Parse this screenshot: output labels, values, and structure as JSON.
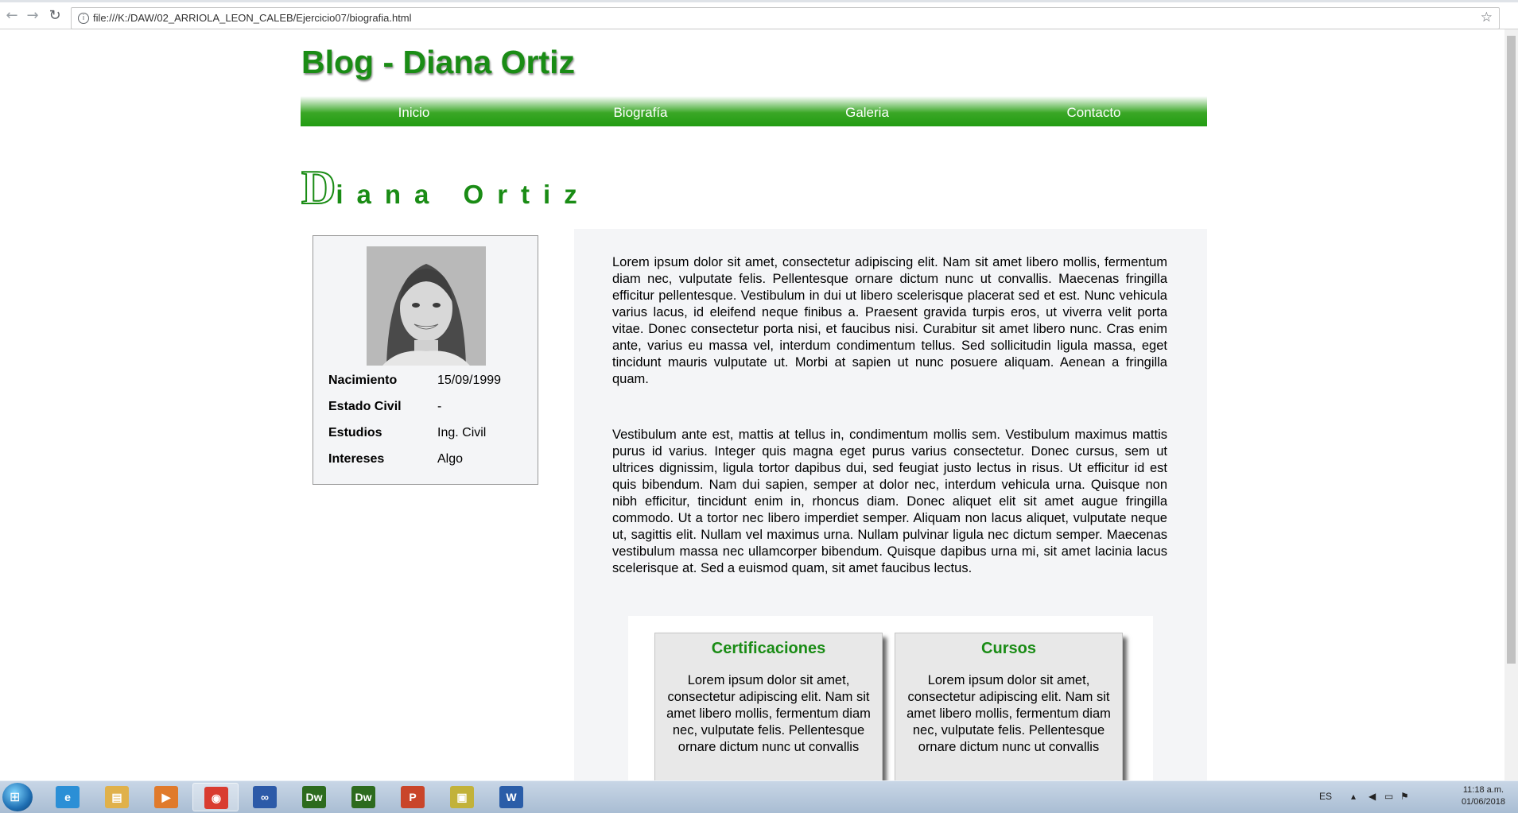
{
  "browser": {
    "url": "file:///K:/DAW/02_ARRIOLA_LEON_CALEB/Ejercicio07/biografia.html",
    "nav_back": "←",
    "nav_forward": "→",
    "reload": "↻",
    "info": "i",
    "bookmark": "☆"
  },
  "site": {
    "title": "Blog - Diana Ortiz",
    "menu": [
      "Inicio",
      "Biografía",
      "Galeria",
      "Contacto"
    ]
  },
  "bio": {
    "heading_first": "D",
    "heading_rest": "iana Ortiz",
    "profile": [
      {
        "label": "Nacimiento",
        "value": "15/09/1999"
      },
      {
        "label": "Estado Civil",
        "value": "-"
      },
      {
        "label": "Estudios",
        "value": "Ing. Civil"
      },
      {
        "label": "Intereses",
        "value": "Algo"
      }
    ],
    "paragraphs": [
      "Lorem ipsum dolor sit amet, consectetur adipiscing elit. Nam sit amet libero mollis, fermentum diam nec, vulputate felis. Pellentesque ornare dictum nunc ut convallis. Maecenas fringilla efficitur pellentesque. Vestibulum in dui ut libero scelerisque placerat sed et est. Nunc vehicula varius lacus, id eleifend neque finibus a. Praesent gravida turpis eros, ut viverra velit porta vitae. Donec consectetur porta nisi, et faucibus nisi. Curabitur sit amet libero nunc. Cras enim ante, varius eu massa vel, interdum condimentum tellus. Sed sollicitudin ligula massa, eget tincidunt mauris vulputate ut. Morbi at sapien ut nunc posuere aliquam. Aenean a fringilla quam.",
      "Vestibulum ante est, mattis at tellus in, condimentum mollis sem. Vestibulum maximus mattis purus id varius. Integer quis magna eget purus varius consectetur. Donec cursus, sem ut ultrices dignissim, ligula tortor dapibus dui, sed feugiat justo lectus in risus. Ut efficitur id est quis bibendum. Nam dui sapien, semper at dolor nec, interdum vehicula urna. Quisque non nibh efficitur, tincidunt enim in, rhoncus diam. Donec aliquet elit sit amet augue fringilla commodo. Ut a tortor nec libero imperdiet semper. Aliquam non lacus aliquet, vulputate neque ut, sagittis elit. Nullam vel maximus urna. Nullam pulvinar ligula nec dictum semper. Maecenas vestibulum massa nec ullamcorper bibendum. Quisque dapibus urna mi, sit amet lacinia lacus scelerisque at. Sed a euismod quam, sit amet faucibus lectus."
    ],
    "cards": [
      {
        "title": "Certificaciones",
        "text": "Lorem ipsum dolor sit amet, consectetur adipiscing elit. Nam sit amet libero mollis, fermentum diam nec, vulputate felis. Pellentesque ornare dictum nunc ut convallis"
      },
      {
        "title": "Cursos",
        "text": "Lorem ipsum dolor sit amet, consectetur adipiscing elit. Nam sit amet libero mollis, fermentum diam nec, vulputate felis. Pellentesque ornare dictum nunc ut convallis"
      }
    ]
  },
  "taskbar": {
    "apps": [
      {
        "name": "internet-explorer-icon",
        "glyph": "e",
        "color": "#2b8fd6"
      },
      {
        "name": "file-explorer-icon",
        "glyph": "▤",
        "color": "#e0b14a"
      },
      {
        "name": "media-player-icon",
        "glyph": "▶",
        "color": "#e07a2b"
      },
      {
        "name": "chrome-icon",
        "glyph": "◉",
        "color": "#d93c30"
      },
      {
        "name": "infinity-app-icon",
        "glyph": "∞",
        "color": "#2c5aa8"
      },
      {
        "name": "dreamweaver-icon",
        "glyph": "Dw",
        "color": "#2d6b1e"
      },
      {
        "name": "dreamweaver-icon",
        "glyph": "Dw",
        "color": "#2d6b1e"
      },
      {
        "name": "powerpoint-icon",
        "glyph": "P",
        "color": "#c9452a"
      },
      {
        "name": "photo-app-icon",
        "glyph": "▣",
        "color": "#c2b23a"
      },
      {
        "name": "word-icon",
        "glyph": "W",
        "color": "#2a5da8"
      }
    ],
    "language": "ES",
    "time": "11:18 a.m.",
    "date": "01/06/2018"
  },
  "colors": {
    "accent_green": "#1a8c15",
    "menu_green": "#229c12",
    "panel_bg": "#f4f5f7",
    "card_bg": "#e8e8e8"
  }
}
